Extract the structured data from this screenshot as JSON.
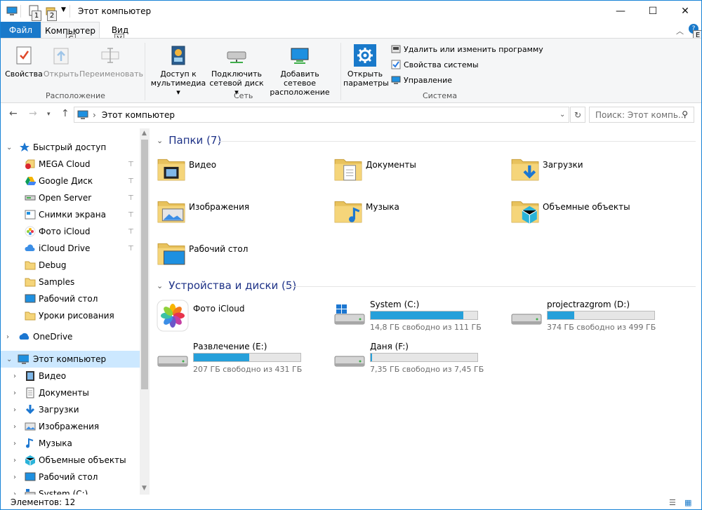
{
  "title": "Этот компьютер",
  "qat": {
    "keytip1": "1",
    "keytip2": "2"
  },
  "tabs": {
    "file": "Файл",
    "computer": "Компьютер",
    "view": "Вид",
    "computer_keytip": "C",
    "view_keytip": "V",
    "help_keytip": "E"
  },
  "ribbon": {
    "properties": "Свойства",
    "open": "Открыть",
    "rename": "Переименовать",
    "group_location": "Расположение",
    "media_access_1": "Доступ к",
    "media_access_2": "мультимедиа",
    "map_drive_1": "Подключить",
    "map_drive_2": "сетевой диск",
    "add_location_1": "Добавить сетевое",
    "add_location_2": "расположение",
    "group_network": "Сеть",
    "open_settings_1": "Открыть",
    "open_settings_2": "параметры",
    "uninstall": "Удалить или изменить программу",
    "system_properties": "Свойства системы",
    "manage": "Управление",
    "group_system": "Система"
  },
  "address": {
    "path": "Этот компьютер",
    "search_placeholder": "Поиск: Этот компь..."
  },
  "sidebar": {
    "quick_access": "Быстрый доступ",
    "qa_items": [
      {
        "label": "MEGA Cloud",
        "icon": "mega-icon"
      },
      {
        "label": "Google Диск",
        "icon": "google-drive-icon"
      },
      {
        "label": "Open Server",
        "icon": "server-icon"
      },
      {
        "label": "Снимки экрана",
        "icon": "screenshots-icon"
      },
      {
        "label": "Фото iCloud",
        "icon": "icloud-photos-icon"
      },
      {
        "label": "iCloud Drive",
        "icon": "icloud-drive-icon"
      },
      {
        "label": "Debug",
        "icon": "folder-icon"
      },
      {
        "label": "Samples",
        "icon": "folder-icon"
      },
      {
        "label": "Рабочий стол",
        "icon": "desktop-icon"
      },
      {
        "label": "Уроки рисования",
        "icon": "folder-icon"
      }
    ],
    "onedrive": "OneDrive",
    "this_pc": "Этот компьютер",
    "pc_items": [
      {
        "label": "Видео"
      },
      {
        "label": "Документы"
      },
      {
        "label": "Загрузки"
      },
      {
        "label": "Изображения"
      },
      {
        "label": "Музыка"
      },
      {
        "label": "Объемные объекты"
      },
      {
        "label": "Рабочий стол"
      },
      {
        "label": "System (C:)"
      }
    ]
  },
  "content": {
    "folders_header": "Папки (7)",
    "folders": [
      {
        "label": "Видео",
        "icon": "videos-folder-icon"
      },
      {
        "label": "Документы",
        "icon": "documents-folder-icon"
      },
      {
        "label": "Загрузки",
        "icon": "downloads-folder-icon"
      },
      {
        "label": "Изображения",
        "icon": "pictures-folder-icon"
      },
      {
        "label": "Музыка",
        "icon": "music-folder-icon"
      },
      {
        "label": "Объемные объекты",
        "icon": "3d-objects-folder-icon"
      },
      {
        "label": "Рабочий стол",
        "icon": "desktop-folder-icon"
      }
    ],
    "devices_header": "Устройства и диски (5)",
    "icloud_photos": "Фото iCloud",
    "drives": [
      {
        "label": "System (C:)",
        "free_text": "14,8 ГБ свободно из 111 ГБ",
        "used_fraction": 0.867
      },
      {
        "label": "projectrazgrom (D:)",
        "free_text": "374 ГБ свободно из 499 ГБ",
        "used_fraction": 0.25
      },
      {
        "label": "Развлечение (E:)",
        "free_text": "207 ГБ свободно из 431 ГБ",
        "used_fraction": 0.52
      },
      {
        "label": "Даня (F:)",
        "free_text": "7,35 ГБ свободно из 7,45 ГБ",
        "used_fraction": 0.013
      }
    ]
  },
  "status": {
    "items": "Элементов: 12"
  },
  "colors": {
    "accent": "#1979ca",
    "bar_fill": "#26a0da",
    "header": "#1e3287",
    "selection": "#cce8ff"
  }
}
